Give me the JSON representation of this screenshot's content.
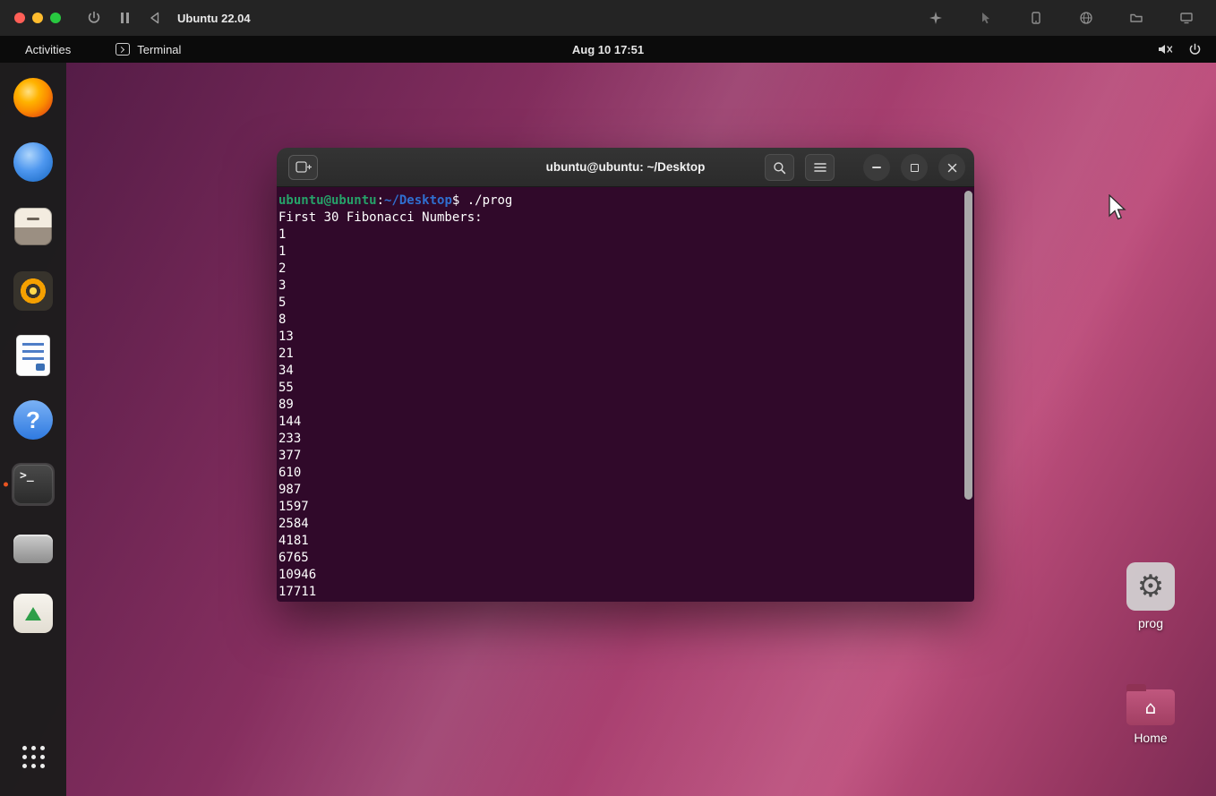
{
  "macos_bar": {
    "title": "Ubuntu 22.04"
  },
  "panel": {
    "activities_label": "Activities",
    "app_name": "Terminal",
    "clock": "Aug 10 17:51"
  },
  "dock": {
    "items": [
      "firefox",
      "thunderbird",
      "files",
      "rhythmbox",
      "libreoffice-writer",
      "help",
      "terminal",
      "system",
      "ubuntu-software",
      "app-grid"
    ],
    "active_item": "terminal",
    "help_glyph": "?",
    "terminal_glyph": ">_"
  },
  "terminal_window": {
    "title": "ubuntu@ubuntu: ~/Desktop",
    "prompt": {
      "user": "ubuntu@ubuntu",
      "colon": ":",
      "path": "~/Desktop",
      "dollar": "$",
      "command": " ./prog"
    },
    "output_header": "First 30 Fibonacci Numbers:",
    "output_numbers": [
      "1",
      "1",
      "2",
      "3",
      "5",
      "8",
      "13",
      "21",
      "34",
      "55",
      "89",
      "144",
      "233",
      "377",
      "610",
      "987",
      "1597",
      "2584",
      "4181",
      "6765",
      "10946",
      "17711"
    ]
  },
  "desktop_icons": {
    "prog": {
      "label": "prog",
      "glyph": "⚙"
    },
    "home": {
      "label": "Home",
      "glyph": "⌂"
    }
  },
  "colors": {
    "accent_orange": "#e95420",
    "terminal_background": "#30092a",
    "prompt_green": "#26a269",
    "path_blue": "#2f6fd0",
    "wallpaper_magenta": "#aa4171"
  }
}
